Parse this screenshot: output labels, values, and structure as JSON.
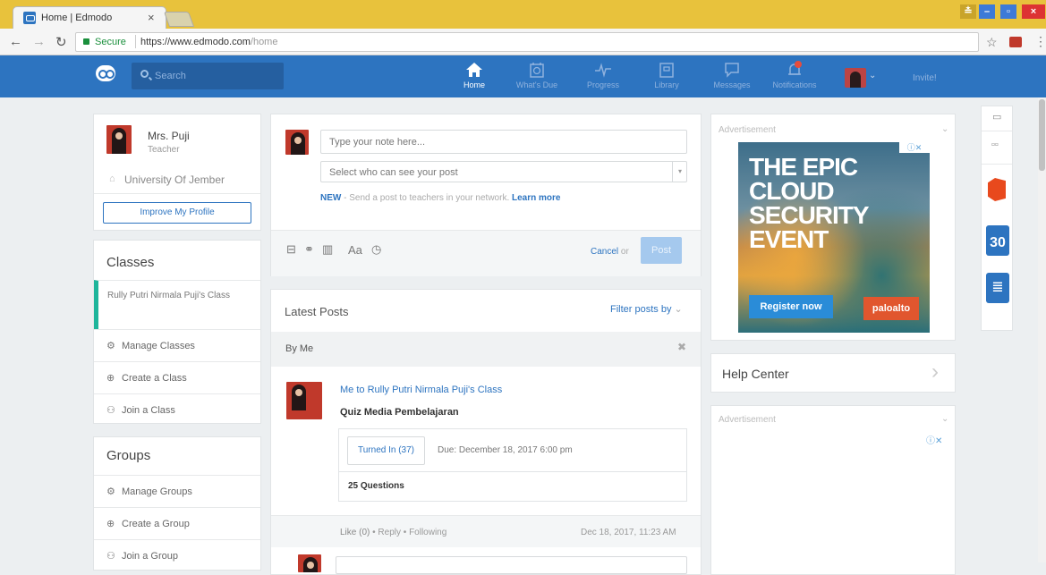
{
  "browser": {
    "tab_title": "Home | Edmodo",
    "secure_label": "Secure",
    "url_main": "https://www.edmodo.com",
    "url_path": "/home"
  },
  "topnav": {
    "search_placeholder": "Search",
    "items": [
      {
        "label": "Home",
        "icon": "home-icon",
        "active": true
      },
      {
        "label": "What's Due",
        "icon": "calendar-icon"
      },
      {
        "label": "Progress",
        "icon": "progress-icon"
      },
      {
        "label": "Library",
        "icon": "library-icon"
      },
      {
        "label": "Messages",
        "icon": "message-icon"
      },
      {
        "label": "Notifications",
        "icon": "bell-icon"
      }
    ],
    "invite_label": "Invite!"
  },
  "profile": {
    "name": "Mrs. Puji",
    "role": "Teacher",
    "school": "University Of Jember",
    "improve_button": "Improve My Profile"
  },
  "classes": {
    "heading": "Classes",
    "active_class": "Rully Putri Nirmala Puji's Class",
    "manage": "Manage Classes",
    "create": "Create a Class",
    "join": "Join a Class"
  },
  "groups": {
    "heading": "Groups",
    "manage": "Manage Groups",
    "create": "Create a Group",
    "join": "Join a Group"
  },
  "composer": {
    "note_placeholder": "Type your note here...",
    "audience_placeholder": "Select who can see your post",
    "new_label": "NEW",
    "new_text": "- Send a post to teachers in your network.",
    "learn_more": "Learn more",
    "cancel": "Cancel",
    "or": "or",
    "post_button": "Post"
  },
  "feed": {
    "heading": "Latest Posts",
    "filter": "Filter posts by",
    "by_me": "By Me",
    "post": {
      "recipient": "Me to Rully Putri Nirmala Puji's Class",
      "title": "Quiz Media Pembelajaran",
      "turned_in": "Turned In (37)",
      "due": "Due: December 18, 2017 6:00 pm",
      "questions": "25 Questions",
      "like": "Like (0)",
      "reply": "Reply",
      "following": "Following",
      "timestamp": "Dec 18, 2017, 11:23 AM"
    }
  },
  "ads": {
    "label": "Advertisement",
    "ad_title_lines": [
      "THE EPIC",
      "CLOUD",
      "SECURITY",
      "EVENT"
    ],
    "register": "Register now",
    "brand": "paloalto",
    "help_center": "Help Center"
  }
}
